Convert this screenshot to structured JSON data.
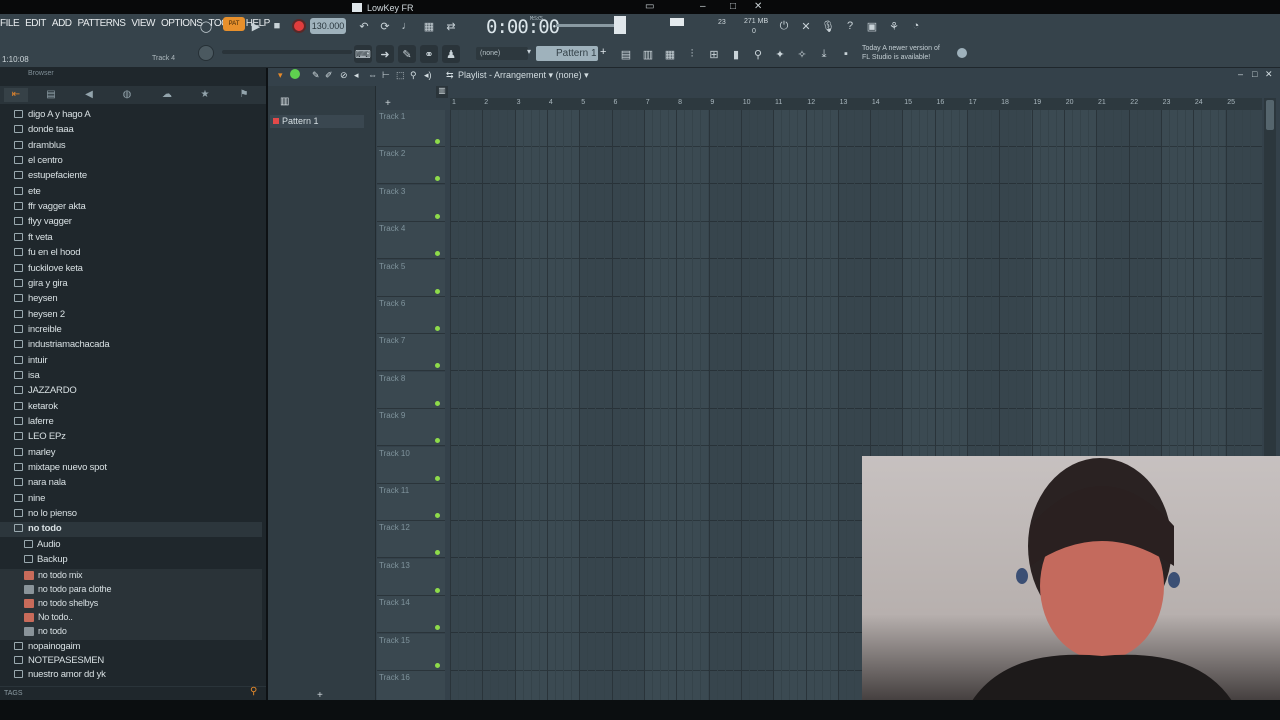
{
  "window": {
    "title": "LowKey FR"
  },
  "menu": [
    "FILE",
    "EDIT",
    "ADD",
    "PATTERNS",
    "VIEW",
    "OPTIONS",
    "TOOLS",
    "HELP"
  ],
  "transport": {
    "pat_label": "PAT",
    "tempo": "130.000",
    "time": "0:00:00",
    "time_unit": "M:S:CS",
    "song_time": "1:10:08",
    "hint": "Track 4"
  },
  "cpu": {
    "value_a": "23",
    "memory": "271 MB",
    "value_b": "0"
  },
  "toolbar2": {
    "none_label": "(none)",
    "pattern_label": "Pattern 1"
  },
  "news": {
    "line1": "Today  A newer version of",
    "line2": "FL Studio is available!"
  },
  "browser": {
    "title": "Browser",
    "tags_label": "TAGS",
    "items": [
      {
        "label": "digo A y hago A",
        "kind": "folder"
      },
      {
        "label": "donde taaa",
        "kind": "folder"
      },
      {
        "label": "dramblus",
        "kind": "folder"
      },
      {
        "label": "el centro",
        "kind": "folder"
      },
      {
        "label": "estupefaciente",
        "kind": "folder"
      },
      {
        "label": "ete",
        "kind": "folder"
      },
      {
        "label": "ffr vagger akta",
        "kind": "folder"
      },
      {
        "label": "flyy vagger",
        "kind": "folder"
      },
      {
        "label": "ft veta",
        "kind": "folder"
      },
      {
        "label": "fu en el hood",
        "kind": "folder"
      },
      {
        "label": "fuckilove keta",
        "kind": "folder"
      },
      {
        "label": "gira y gira",
        "kind": "folder"
      },
      {
        "label": "heysen",
        "kind": "folder"
      },
      {
        "label": "heysen 2",
        "kind": "folder"
      },
      {
        "label": "increible",
        "kind": "folder"
      },
      {
        "label": "industriamachacada",
        "kind": "folder"
      },
      {
        "label": "intuir",
        "kind": "folder"
      },
      {
        "label": "isa",
        "kind": "folder"
      },
      {
        "label": "JAZZARDO",
        "kind": "folder"
      },
      {
        "label": "ketarok",
        "kind": "folder"
      },
      {
        "label": "laferre",
        "kind": "folder"
      },
      {
        "label": "LEO EPz",
        "kind": "folder"
      },
      {
        "label": "marley",
        "kind": "folder"
      },
      {
        "label": "mixtape nuevo spot",
        "kind": "folder"
      },
      {
        "label": "nara nala",
        "kind": "folder"
      },
      {
        "label": "nine",
        "kind": "folder"
      },
      {
        "label": "no lo pienso",
        "kind": "folder"
      },
      {
        "label": "no todo",
        "kind": "open"
      },
      {
        "label": "Audio",
        "kind": "sub"
      },
      {
        "label": "Backup",
        "kind": "sub"
      },
      {
        "label": "no todo mix",
        "kind": "file"
      },
      {
        "label": "no todo para clothe",
        "kind": "filew"
      },
      {
        "label": "no todo shelbys",
        "kind": "file"
      },
      {
        "label": "No todo..",
        "kind": "file"
      },
      {
        "label": "no todo",
        "kind": "filew"
      },
      {
        "label": "nopainogaim",
        "kind": "folder"
      },
      {
        "label": "NOTEPASESMEN",
        "kind": "folder"
      },
      {
        "label": "nuestro amor dd yk",
        "kind": "folder"
      }
    ]
  },
  "playlist": {
    "title": "Playlist - Arrangement",
    "arrangement": "(none)",
    "pattern": "Pattern 1",
    "ruler": [
      "1",
      "2",
      "3",
      "4",
      "5",
      "6",
      "7",
      "8",
      "9",
      "10",
      "11",
      "12",
      "13",
      "14",
      "15",
      "16",
      "17",
      "18",
      "19",
      "20",
      "21",
      "22",
      "23",
      "24",
      "25"
    ],
    "tracks": [
      "Track 1",
      "Track 2",
      "Track 3",
      "Track 4",
      "Track 5",
      "Track 6",
      "Track 7",
      "Track 8",
      "Track 9",
      "Track 10",
      "Track 11",
      "Track 12",
      "Track 13",
      "Track 14",
      "Track 15",
      "Track 16"
    ]
  }
}
